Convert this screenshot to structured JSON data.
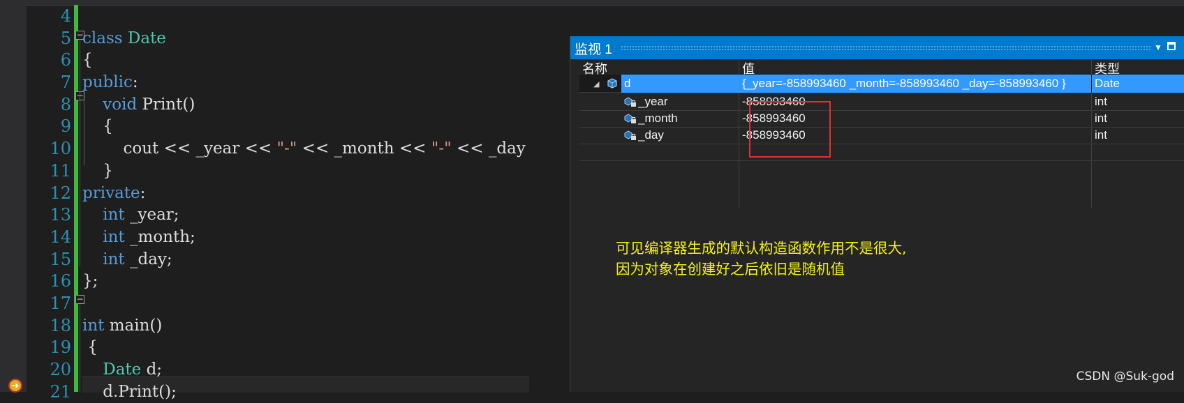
{
  "editor": {
    "line_numbers": [
      "4",
      "5",
      "6",
      "7",
      "8",
      "9",
      "10",
      "11",
      "12",
      "13",
      "14",
      "15",
      "16",
      "17",
      "18",
      "19",
      "20",
      "21"
    ]
  },
  "code": {
    "l5_kw": "class",
    "l5_name": "Date",
    "l6": "{",
    "l7_kw": "public",
    "l7_colon": ":",
    "l8_kw": "void",
    "l8_rest": " Print()",
    "l9": "{",
    "l10_a": "cout << _year << ",
    "l10_s1": "\"-\"",
    "l10_b": " << _month << ",
    "l10_s2": "\"-\"",
    "l10_c": " << _day",
    "l11": "}",
    "l12_kw": "private",
    "l12_colon": ":",
    "l13_kw": "int",
    "l13_rest": " _year;",
    "l14_kw": "int",
    "l14_rest": " _month;",
    "l15_kw": "int",
    "l15_rest": " _day;",
    "l16": "};",
    "l18_kw": "int",
    "l18_rest": " main()",
    "l19": "{",
    "l20_ty": "Date",
    "l20_rest": " d;",
    "l21": "d.Print();"
  },
  "watch": {
    "title": "监视 1",
    "headers": {
      "name": "名称",
      "value": "值",
      "type": "类型"
    },
    "rows": [
      {
        "name": "d",
        "value": "{_year=-858993460 _month=-858993460 _day=-858993460 }",
        "type": "Date"
      },
      {
        "name": "_year",
        "value": "-858993460",
        "type": "int"
      },
      {
        "name": "_month",
        "value": "-858993460",
        "type": "int"
      },
      {
        "name": "_day",
        "value": "-858993460",
        "type": "int"
      }
    ],
    "icons": {
      "expander": "collapse-triangle-icon",
      "object": "object-variable-icon",
      "field": "private-field-icon"
    }
  },
  "annotation": {
    "line1": "可见编译器生成的默认构造函数作用不是很大,",
    "line2": "因为对象在创建好之后依旧是随机值"
  },
  "watermark": "CSDN @Suk-god",
  "colors": {
    "accent": "#007acc",
    "annotation": "#f3f312",
    "highlight_box": "#e03030",
    "selection": "#3399ff"
  }
}
